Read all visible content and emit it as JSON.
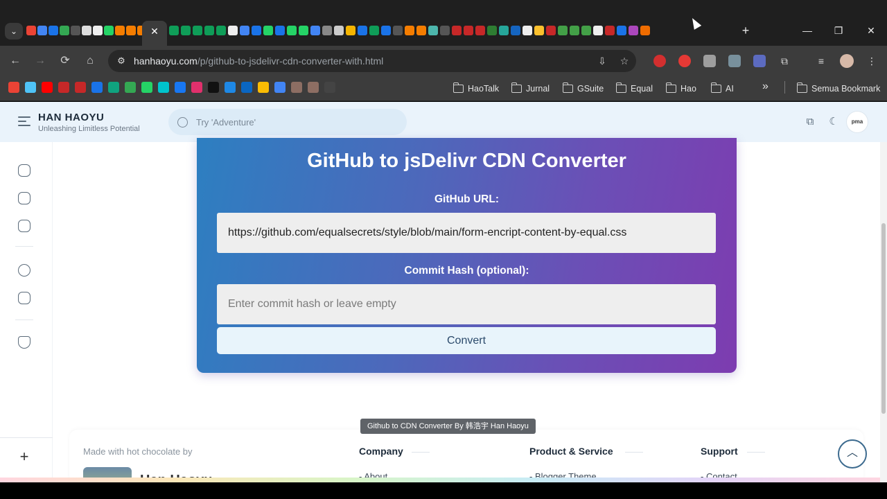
{
  "browser": {
    "tabs": {
      "close_glyph": "✕",
      "new_tab_glyph": "+",
      "search_glyph": "⌄"
    },
    "window": {
      "minimize": "—",
      "restore": "❐",
      "close": "✕"
    },
    "toolbar": {
      "back": "←",
      "forward": "→",
      "reload": "⟳",
      "home": "⌂",
      "url_host": "hanhaoyu.com",
      "url_path": "/p/github-to-jsdelivr-cdn-converter-with.html"
    },
    "bookmarks": {
      "folders": [
        "HaoTalk",
        "Jurnal",
        "GSuite",
        "Equal",
        "Hao",
        "AI"
      ],
      "more": "»",
      "all_bookmarks": "Semua Bookmark"
    }
  },
  "site": {
    "brand_title": "HAN HAOYU",
    "brand_subtitle": "Unleashing Limitless Potential",
    "search_placeholder": "Try 'Adventure'",
    "avatar_text": "pma"
  },
  "converter": {
    "title": "GitHub to jsDelivr CDN Converter",
    "github_url_label": "GitHub URL:",
    "github_url_value": "https://github.com/equalsecrets/style/blob/main/form-encript-content-by-equal.css",
    "commit_label": "Commit Hash (optional):",
    "commit_placeholder": "Enter commit hash or leave empty",
    "convert_label": "Convert"
  },
  "tooltip": "Github to CDN Converter By 韩浩宇 Han Haoyu",
  "footer": {
    "made_with": "Made with hot chocolate by",
    "author": "Han Haoyu",
    "columns": [
      {
        "title": "Company",
        "link": "About"
      },
      {
        "title": "Product & Service",
        "link": "Blogger Theme"
      },
      {
        "title": "Support",
        "link": "Contact"
      }
    ],
    "scroll_top": "︿"
  },
  "colors": {
    "card_gradient_start": "#2d7fc1",
    "card_gradient_end": "#7d3cb0",
    "header_bg": "#eaf3fb"
  }
}
